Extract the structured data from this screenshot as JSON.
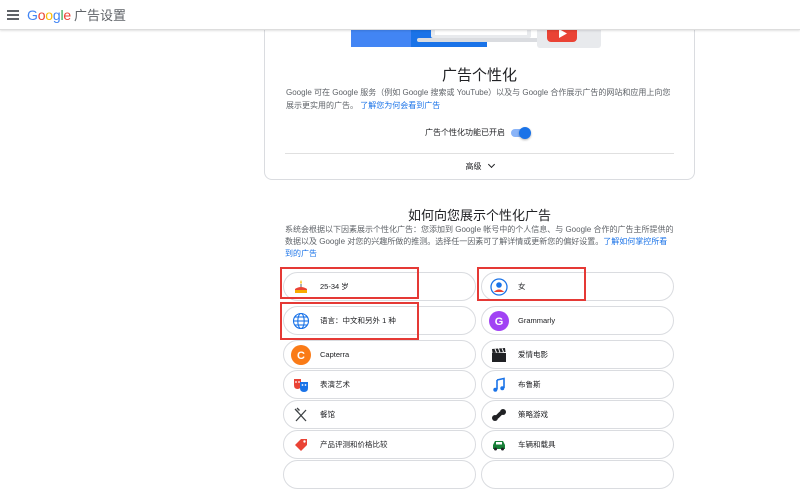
{
  "topbar": {
    "menu_icon": "hamburger-menu-icon",
    "logo_text": "Google",
    "app_title": "广告设置"
  },
  "card": {
    "illustration_icon": "ads-illustration-icon",
    "title": "广告个性化",
    "desc_text": "Google 可在 Google 服务（例如 Google 搜索或 YouTube）以及与 Google 合作展示广告的网站和应用上向您展示更实用的广告。",
    "desc_link": "了解您为何会看到广告",
    "toggle_label": "广告个性化功能已开启",
    "advanced_label": "高级"
  },
  "section": {
    "title": "如何向您展示个性化广告",
    "desc_text": "系统会根据以下因素展示个性化广告：您添加到 Google 帐号中的个人信息、与 Google 合作的广告主所提供的数据以及 Google 对您的兴趣所做的推测。选择任一因素可了解详情或更新您的偏好设置。",
    "desc_link": "了解如何掌控所看到的广告"
  },
  "factors": [
    {
      "label": "25-34 岁",
      "icon": "cake-icon"
    },
    {
      "label": "女",
      "icon": "person-icon"
    },
    {
      "label": "语言：中文和另外 1 种",
      "icon": "globe-icon"
    },
    {
      "label": "Grammarly",
      "icon": "grammarly-g-icon",
      "letter": "G"
    },
    {
      "label": "Capterra",
      "icon": "capterra-c-icon",
      "letter": "C"
    },
    {
      "label": "爱情电影",
      "icon": "clapperboard-icon"
    },
    {
      "label": "表演艺术",
      "icon": "theater-masks-icon"
    },
    {
      "label": "布鲁斯",
      "icon": "music-note-icon"
    },
    {
      "label": "餐馆",
      "icon": "fork-knife-icon"
    },
    {
      "label": "策略游戏",
      "icon": "game-controller-icon"
    },
    {
      "label": "产品评测和价格比较",
      "icon": "price-tag-icon"
    },
    {
      "label": "车辆和载具",
      "icon": "car-icon"
    }
  ],
  "colors": {
    "accent": "#1a73e8",
    "highlight_box": "#e53935"
  }
}
